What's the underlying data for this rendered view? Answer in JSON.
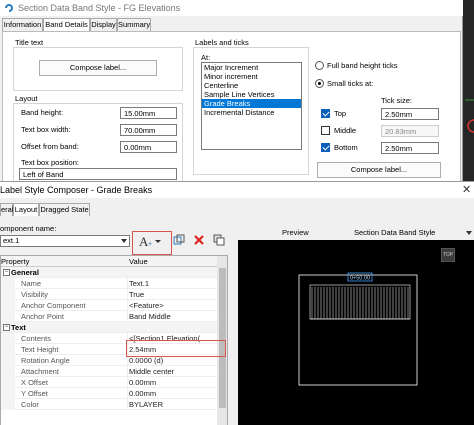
{
  "back_dialog": {
    "title": "Section Data Band Style - FG Elevations",
    "tabs": [
      "Information",
      "Band Details",
      "Display",
      "Summary"
    ],
    "title_text_label": "Title text",
    "compose_label_button": "Compose label...",
    "layout_label": "Layout",
    "band_height_label": "Band height:",
    "band_height_value": "15.00mm",
    "text_box_width_label": "Text box width:",
    "text_box_width_value": "70.00mm",
    "offset_label": "Offset from band:",
    "offset_value": "0.00mm",
    "text_box_position_label": "Text box position:",
    "text_box_position_value": "Left of Band",
    "labels_ticks_label": "Labels and ticks",
    "at_label": "At:",
    "at_items": [
      "Major Increment",
      "Minor increment",
      "Centerline",
      "Sample Line Vertices",
      "Grade Breaks",
      "Incremental Distance"
    ],
    "at_selected": "Grade Breaks",
    "full_band_label": "Full band height ticks",
    "small_ticks_label": "Small ticks at:",
    "tick_size_label": "Tick size:",
    "top_label": "Top",
    "top_value": "2.50mm",
    "middle_label": "Middle",
    "middle_value": "20.83mm",
    "bottom_label": "Bottom",
    "bottom_value": "2.50mm",
    "compose_label_button2": "Compose label..."
  },
  "front_dialog": {
    "title": "Label Style Composer - Grade Breaks",
    "tabs": [
      "eral",
      "Layout",
      "Dragged State"
    ],
    "component_name_label": "omponent name:",
    "component_value": "ext.1",
    "grid_header_property": "Property",
    "grid_header_value": "Value",
    "general_category": "General",
    "general_rows": [
      {
        "k": "Name",
        "v": "Text.1"
      },
      {
        "k": "Visibility",
        "v": "True"
      },
      {
        "k": "Anchor Component",
        "v": "<Feature>"
      },
      {
        "k": "Anchor Point",
        "v": "Band Middle"
      }
    ],
    "text_category": "Text",
    "text_rows": [
      {
        "k": "Contents",
        "v": "<[Section1 Elevation(..."
      },
      {
        "k": "Text Height",
        "v": "2.54mm"
      },
      {
        "k": "Rotation Angle",
        "v": "0.0000 (d)"
      },
      {
        "k": "Attachment",
        "v": "Middle center"
      },
      {
        "k": "X Offset",
        "v": "0.00mm"
      },
      {
        "k": "Y Offset",
        "v": "0.00mm"
      },
      {
        "k": "Color",
        "v": "BYLAYER"
      }
    ],
    "preview_label": "Preview",
    "preview_style": "Section Data Band Style",
    "preview_top_button": "TOP",
    "preview_label_text": "0+50.00"
  },
  "colors": {
    "accent_blue": "#0078d7",
    "highlight_red": "#d9534f",
    "preview_bg": "#000000",
    "preview_line": "#ffffff",
    "preview_label_box": "#3fa3ff"
  }
}
